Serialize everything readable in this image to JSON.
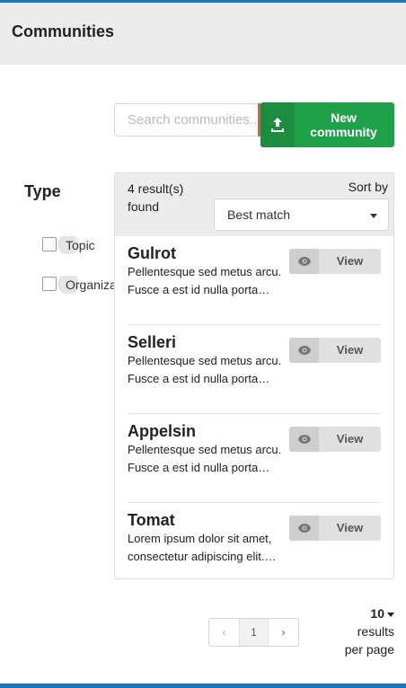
{
  "header": {
    "title": "Communities"
  },
  "search": {
    "placeholder": "Search communities..."
  },
  "new_button": {
    "label": "New community",
    "icon": "upload-icon"
  },
  "facets": {
    "title": "Type",
    "items": [
      {
        "label": "Topic",
        "checked": false
      },
      {
        "label": "Organization",
        "checked": false
      }
    ]
  },
  "results": {
    "count_text": "4 result(s) found",
    "sort_label": "Sort by",
    "sort_value": "Best match",
    "view_label": "View",
    "items": [
      {
        "name": "Gulrot",
        "description": "Pellentesque sed metus arcu. Fusce a est id nulla porta…"
      },
      {
        "name": "Selleri",
        "description": "Pellentesque sed metus arcu. Fusce a est id nulla porta…"
      },
      {
        "name": "Appelsin",
        "description": "Pellentesque sed metus arcu. Fusce a est id nulla porta…"
      },
      {
        "name": "Tomat",
        "description": "Lorem ipsum dolor sit amet, consectetur adipiscing elit.…"
      }
    ]
  },
  "pagination": {
    "prev": "‹",
    "current": "1",
    "next": "›"
  },
  "per_page": {
    "value": "10",
    "label": "results per page"
  },
  "colors": {
    "accent": "#1f73b7",
    "primary_button": "#21a04a",
    "search_edge": "#e05a47"
  }
}
